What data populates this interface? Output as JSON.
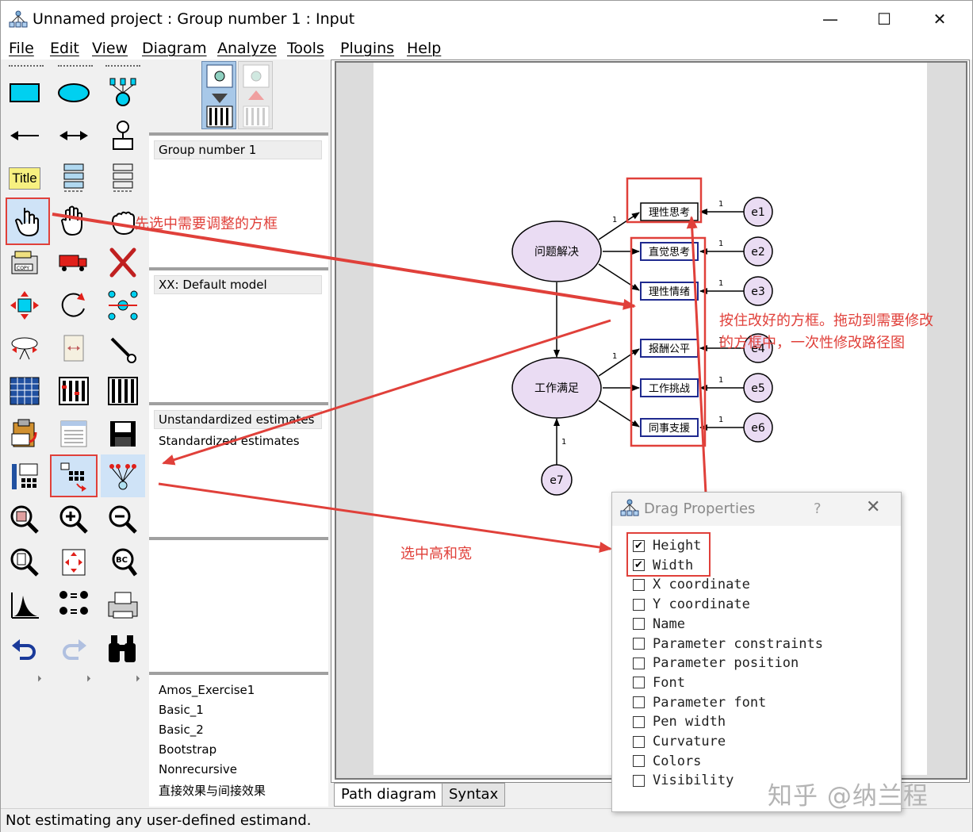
{
  "window": {
    "title": "Unnamed project : Group number 1 : Input",
    "minimize_glyph": "—",
    "maximize_glyph": "☐",
    "close_glyph": "✕"
  },
  "menu": [
    "File",
    "Edit",
    "View",
    "Diagram",
    "Analyze",
    "Tools",
    "Plugins",
    "Help"
  ],
  "toolbox": {
    "title_tool_label": "Title",
    "scroll_glyph": "⏵"
  },
  "panels": {
    "group_list": [
      "Group number 1"
    ],
    "model_list": [
      "XX: Default model"
    ],
    "estimates_list": [
      "Unstandardized estimates",
      "Standardized estimates"
    ],
    "file_list": [
      "Amos_Exercise1",
      "Basic_1",
      "Basic_2",
      "Bootstrap",
      "Nonrecursive",
      "直接效果与间接效果"
    ]
  },
  "tabs": [
    "Path diagram",
    "Syntax"
  ],
  "status": "Not estimating any user-defined estimand.",
  "diagram": {
    "latents": [
      "问题解决",
      "工作满足"
    ],
    "observed": [
      "理性思考",
      "直觉思考",
      "理性情绪",
      "报酬公平",
      "工作挑战",
      "同事支援"
    ],
    "errors": [
      "e1",
      "e2",
      "e3",
      "e4",
      "e5",
      "e6",
      "e7"
    ],
    "path_label": "1"
  },
  "dialog": {
    "title": "Drag Properties",
    "help_glyph": "?",
    "close_glyph": "✕",
    "options": [
      {
        "label": "Height",
        "checked": true
      },
      {
        "label": "Width",
        "checked": true
      },
      {
        "label": "X coordinate",
        "checked": false
      },
      {
        "label": "Y coordinate",
        "checked": false
      },
      {
        "label": "Name",
        "checked": false
      },
      {
        "label": "Parameter constraints",
        "checked": false
      },
      {
        "label": "Parameter position",
        "checked": false
      },
      {
        "label": "Font",
        "checked": false
      },
      {
        "label": "Parameter font",
        "checked": false
      },
      {
        "label": "Pen width",
        "checked": false
      },
      {
        "label": "Curvature",
        "checked": false
      },
      {
        "label": "Colors",
        "checked": false
      },
      {
        "label": "Visibility",
        "checked": false
      }
    ]
  },
  "annotations": {
    "step1": "先选中需要调整的方框",
    "step2_line1": "按住改好的方框。拖动到需要修改",
    "step2_line2": "的方框中，一次性修改路径图",
    "step3": "选中高和宽"
  },
  "watermark": "知乎 @纳兰程",
  "colors": {
    "annotation_red": "#e0403a",
    "latent_fill": "#eadcf3",
    "box_border": "#1f2a8f",
    "tool_selected_bg": "#cfe3f7"
  }
}
